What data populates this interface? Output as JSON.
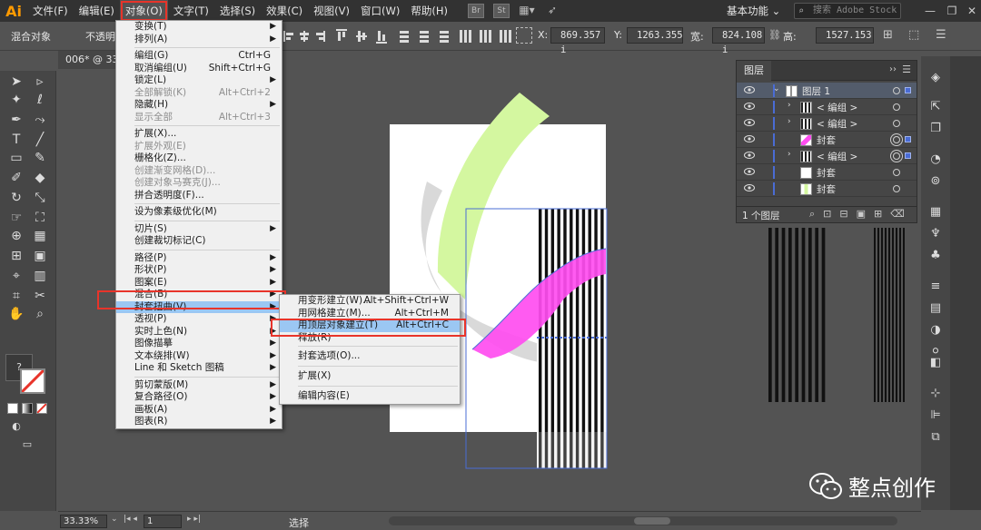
{
  "app": {
    "logo": "Ai"
  },
  "menubar": {
    "items": [
      "文件(F)",
      "编辑(E)",
      "对象(O)",
      "文字(T)",
      "选择(S)",
      "效果(C)",
      "视图(V)",
      "窗口(W)",
      "帮助(H)"
    ],
    "badges": [
      "Br",
      "St"
    ],
    "workspace": "基本功能",
    "stock_search_placeholder": "搜索 Adobe Stock"
  },
  "controlbar": {
    "mode": "混合对象",
    "opacity": "不透明度",
    "x_label": "X:",
    "x_value": "869.357 i",
    "y_label": "Y:",
    "y_value": "1263.355",
    "w_label": "宽:",
    "w_value": "824.108 i",
    "h_label": "高:",
    "h_value": "1527.153"
  },
  "document": {
    "tab": "006* @ 33."
  },
  "object_menu": {
    "items": [
      {
        "label": "变换(T)",
        "sub": true
      },
      {
        "label": "排列(A)",
        "sub": true
      },
      {
        "sep": true
      },
      {
        "label": "编组(G)",
        "sc": "Ctrl+G"
      },
      {
        "label": "取消编组(U)",
        "sc": "Shift+Ctrl+G"
      },
      {
        "label": "锁定(L)",
        "sub": true
      },
      {
        "label": "全部解锁(K)",
        "sc": "Alt+Ctrl+2",
        "disabled": true
      },
      {
        "label": "隐藏(H)",
        "sub": true
      },
      {
        "label": "显示全部",
        "sc": "Alt+Ctrl+3",
        "disabled": true
      },
      {
        "sep": true
      },
      {
        "label": "扩展(X)..."
      },
      {
        "label": "扩展外观(E)",
        "disabled": true
      },
      {
        "label": "栅格化(Z)..."
      },
      {
        "label": "创建渐变网格(D)...",
        "disabled": true
      },
      {
        "label": "创建对象马赛克(J)...",
        "disabled": true
      },
      {
        "label": "拼合透明度(F)..."
      },
      {
        "sep": true
      },
      {
        "label": "设为像素级优化(M)"
      },
      {
        "sep": true
      },
      {
        "label": "切片(S)",
        "sub": true
      },
      {
        "label": "创建裁切标记(C)"
      },
      {
        "sep": true
      },
      {
        "label": "路径(P)",
        "sub": true
      },
      {
        "label": "形状(P)",
        "sub": true
      },
      {
        "label": "图案(E)",
        "sub": true
      },
      {
        "label": "混合(B)",
        "sub": true
      },
      {
        "label": "封套扭曲(V)",
        "sub": true,
        "hl": true
      },
      {
        "label": "透视(P)",
        "sub": true
      },
      {
        "label": "实时上色(N)",
        "sub": true
      },
      {
        "label": "图像描摹",
        "sub": true
      },
      {
        "label": "文本绕排(W)",
        "sub": true
      },
      {
        "label": "Line 和 Sketch 图稿",
        "sub": true
      },
      {
        "sep": true
      },
      {
        "label": "剪切蒙版(M)",
        "sub": true
      },
      {
        "label": "复合路径(O)",
        "sub": true
      },
      {
        "label": "画板(A)",
        "sub": true
      },
      {
        "label": "图表(R)",
        "sub": true
      }
    ]
  },
  "envelope_menu": {
    "items": [
      {
        "label": "用变形建立(W)...",
        "sc": "Alt+Shift+Ctrl+W"
      },
      {
        "label": "用网格建立(M)...",
        "sc": "Alt+Ctrl+M"
      },
      {
        "label": "用顶层对象建立(T)",
        "sc": "Alt+Ctrl+C",
        "hl": true
      },
      {
        "label": "释放(R)"
      },
      {
        "sep": true
      },
      {
        "label": "封套选项(O)..."
      },
      {
        "sep": true
      },
      {
        "label": "扩展(X)"
      },
      {
        "sep": true
      },
      {
        "label": "编辑内容(E)"
      }
    ]
  },
  "layers_panel": {
    "tab": "图层",
    "rows": [
      {
        "name": "图层 1",
        "selected": true,
        "thumb": "layer"
      },
      {
        "name": "< 编组 >",
        "thumb": "stripes"
      },
      {
        "name": "< 编组 >",
        "thumb": "stripes"
      },
      {
        "name": "封套",
        "thumb": "magenta"
      },
      {
        "name": "< 编组 >",
        "thumb": "stripes"
      },
      {
        "name": "封套",
        "thumb": "white"
      },
      {
        "name": "封套",
        "thumb": "green"
      }
    ],
    "count": "1 个图层"
  },
  "statusbar": {
    "zoom": "33.33%",
    "page": "1",
    "tool": "选择"
  },
  "watermark": {
    "text": "整点创作"
  },
  "colors": {
    "accent_red": "#e8342a",
    "menu_highlight": "#9bc7f3",
    "magenta": "#ff4df0",
    "lime": "#d4f7a0"
  }
}
